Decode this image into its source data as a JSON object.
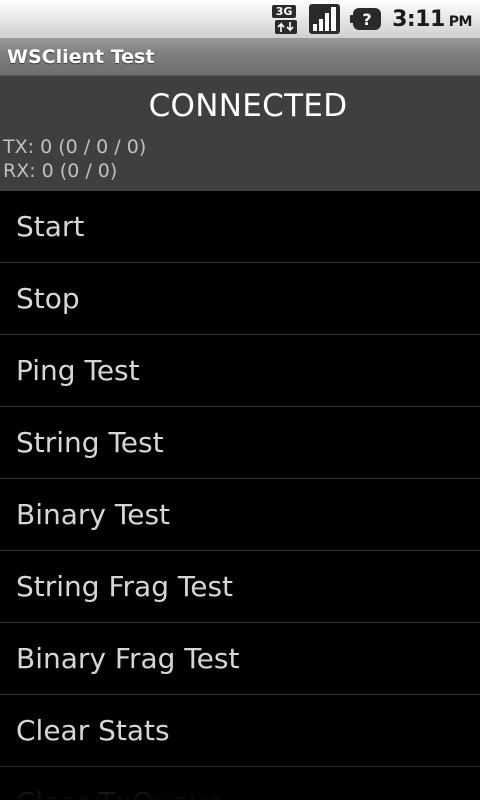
{
  "status_bar": {
    "network_type": "3G",
    "time": "3:11",
    "ampm": "PM"
  },
  "title_bar": {
    "title": "WSClient Test"
  },
  "status_panel": {
    "connection_status": "CONNECTED",
    "tx_stats": "TX: 0 (0 / 0 / 0)",
    "rx_stats": "RX: 0 (0 / 0)"
  },
  "actions": [
    {
      "label": "Start"
    },
    {
      "label": "Stop"
    },
    {
      "label": "Ping Test"
    },
    {
      "label": "String Test"
    },
    {
      "label": "Binary Test"
    },
    {
      "label": "String Frag Test"
    },
    {
      "label": "Binary Frag Test"
    },
    {
      "label": "Clear Stats"
    },
    {
      "label": "Clear TxQueue"
    }
  ],
  "colors": {
    "background": "#000000",
    "panel": "#3f3f3f",
    "title_bar": "#808080",
    "list_text": "#d6d6d6",
    "stats_text": "#c0c0c0"
  }
}
